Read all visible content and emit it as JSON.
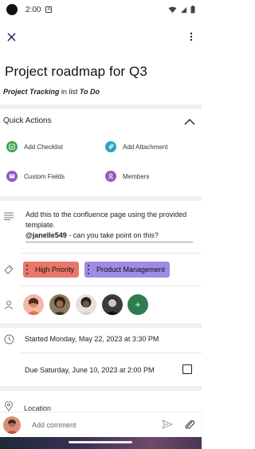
{
  "status": {
    "time": "2:00"
  },
  "card": {
    "title": "Project roadmap for Q3",
    "list_name": "Project Tracking",
    "in_list_text": " in list ",
    "board_name": "To Do"
  },
  "quick_actions": {
    "header": "Quick Actions",
    "items": [
      {
        "label": "Add Checklist",
        "icon": "checklist-icon",
        "color": "#3fa34d"
      },
      {
        "label": "Add Attachment",
        "icon": "attachment-icon",
        "color": "#2aa6c4"
      },
      {
        "label": "Custom Fields",
        "icon": "custom-fields-icon",
        "color": "#8b5cc7"
      },
      {
        "label": "Members",
        "icon": "members-icon",
        "color": "#9b59b6"
      }
    ]
  },
  "description": {
    "line1": "Add this to the confluence page using the provided template.",
    "mention": "@janelle549",
    "line2": "  - can you take point on this?"
  },
  "labels": [
    {
      "text": "High Priority",
      "color": "#e8776a"
    },
    {
      "text": "Product Management",
      "color": "#9f8ae6"
    }
  ],
  "members": {
    "avatars": [
      "member-1",
      "member-2",
      "member-3",
      "member-4"
    ],
    "add_label": "+"
  },
  "dates": {
    "start": "Started Monday, May 22, 2023 at 3:30 PM",
    "due": "Due Saturday, June 10, 2023 at 2:00 PM"
  },
  "location": {
    "label": "Location"
  },
  "comment": {
    "placeholder": "Add comment"
  }
}
